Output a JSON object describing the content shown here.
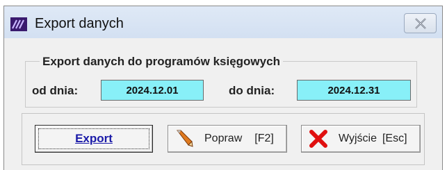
{
  "window": {
    "title": "Export danych"
  },
  "group": {
    "legend": "Export danych do programów księgowych",
    "from_label": "od dnia:",
    "from_value": "2024.12.01",
    "to_label": "do dnia:",
    "to_value": "2024.12.31"
  },
  "buttons": {
    "export": {
      "label": "Export"
    },
    "fix": {
      "label": "Popraw",
      "key": "[F2]"
    },
    "exit": {
      "label": "Wyjście",
      "key": "[Esc]"
    }
  },
  "colors": {
    "date_bg": "#88f0f8",
    "export_text": "#1a1aa8",
    "exit_icon": "#e01010",
    "titlebar": "#d3e0f2"
  },
  "icons": {
    "app": "app-logo-icon",
    "close": "close-icon",
    "fix": "pencil-icon",
    "exit": "red-x-icon"
  }
}
